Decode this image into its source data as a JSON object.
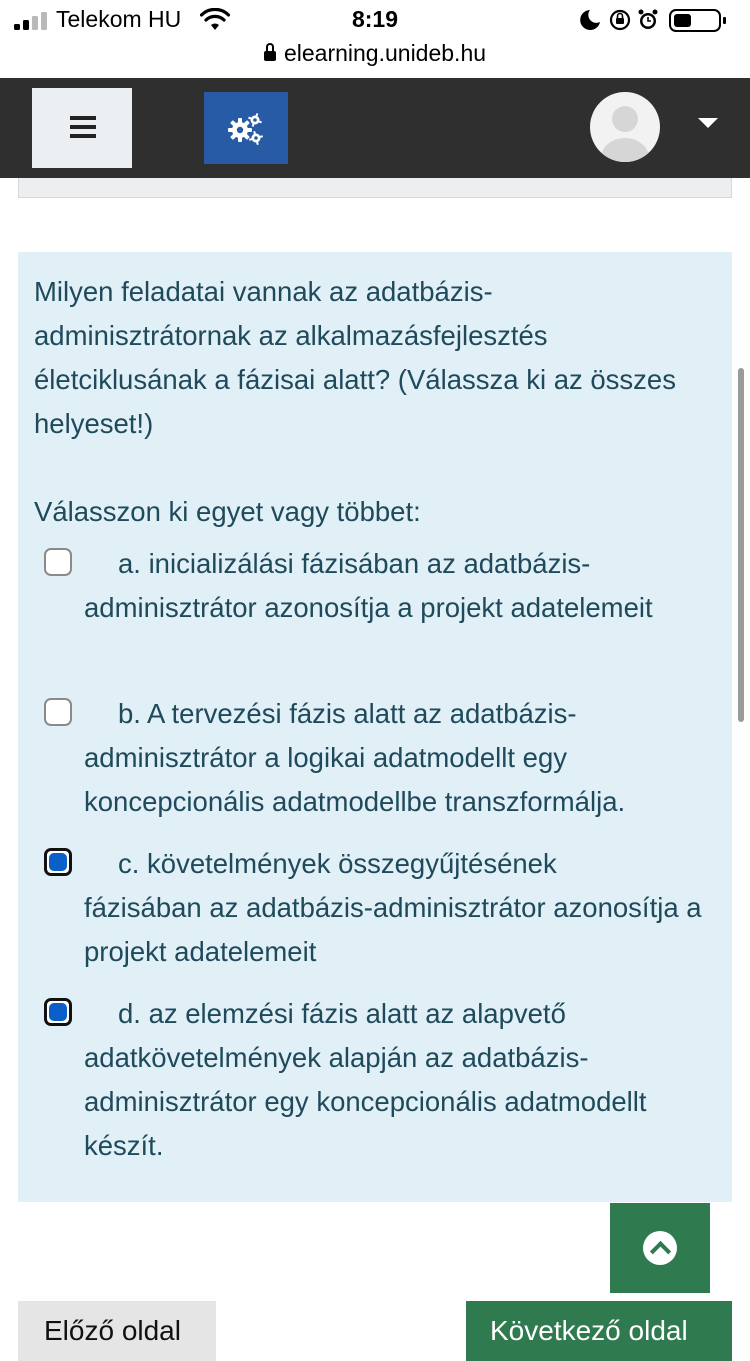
{
  "status_bar": {
    "carrier": "Telekom HU",
    "time": "8:19",
    "url": "elearning.unideb.hu"
  },
  "navbar": {
    "icons": [
      "hamburger-menu-icon",
      "gears-icon",
      "user-avatar-icon",
      "caret-down-icon"
    ]
  },
  "question": {
    "text": "Milyen feladatai vannak az adatbázis-adminisztrátornak az alkalmazásfejlesztés életciklusának a fázisai alatt? (Válassza ki az összes helyeset!)",
    "prompt": "Válasszon ki egyet vagy többet:",
    "answers": [
      {
        "line1": "a. inicializálási fázisában az adatbázis-",
        "rest": "adminisztrátor azonosítja a projekt adatelemeit",
        "checked": false
      },
      {
        "line1": "b. A tervezési fázis alatt az adatbázis-",
        "rest": "adminisztrátor a logikai adatmodellt egy koncepcionális adatmodellbe transzformálja.",
        "checked": false
      },
      {
        "line1": "c. követelmények összegyűjtésének",
        "rest": "fázisában az adatbázis-adminisztrátor azonosítja a projekt adatelemeit",
        "checked": true
      },
      {
        "line1": "d. az elemzési fázis alatt az alapvető",
        "rest": "adatkövetelmények alapján az adatbázis-adminisztrátor egy koncepcionális adatmodellt készít.",
        "checked": true
      }
    ]
  },
  "buttons": {
    "back_to_top_icon": "chevron-up-icon",
    "prev_page": "Előző oldal",
    "next_page": "Következő oldal"
  },
  "colors": {
    "navbar": "#2f2f2f",
    "gear_button": "#285ba6",
    "card_background": "#e1eff7",
    "question_text": "#1f4a5c",
    "checkbox_checked": "#0a60c8",
    "primary_green": "#2f7a4f"
  }
}
